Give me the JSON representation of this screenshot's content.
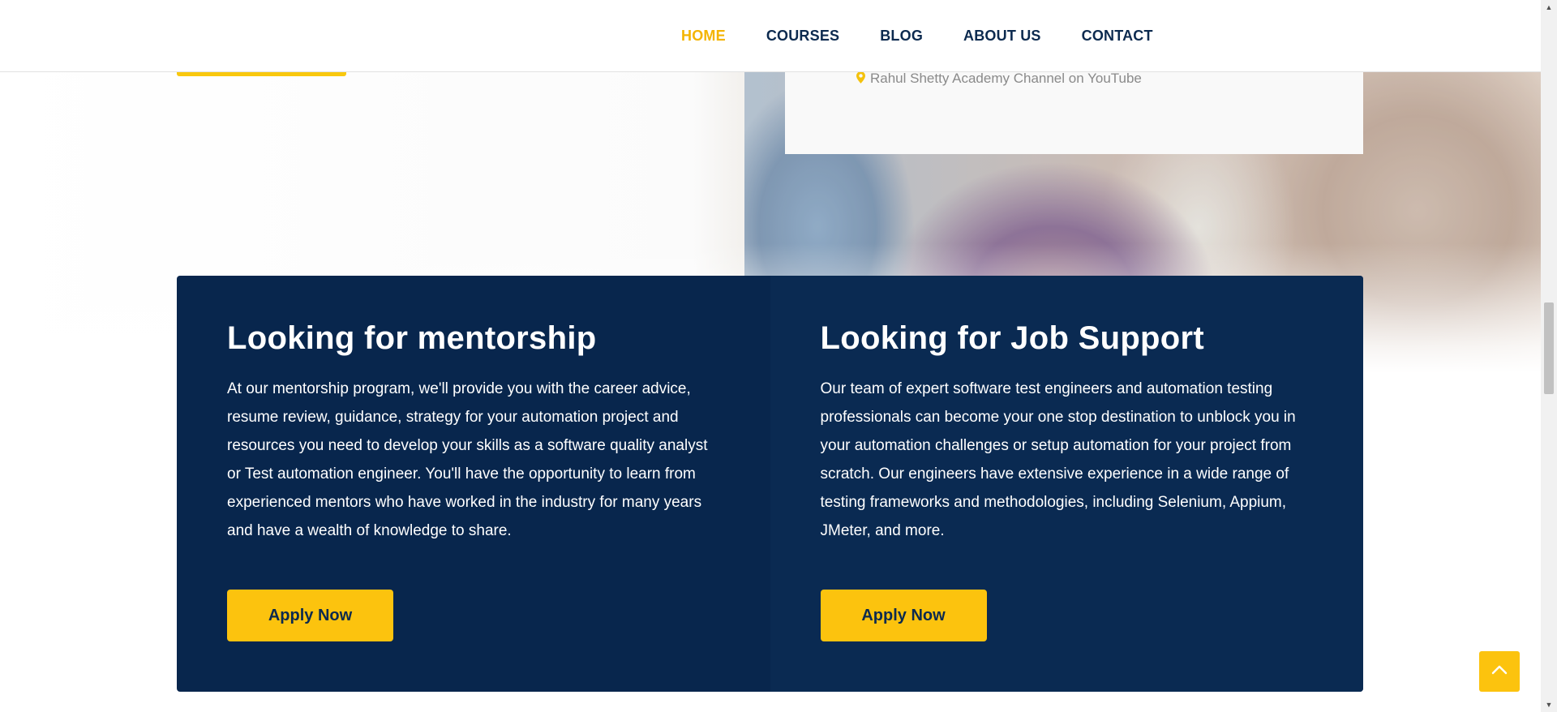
{
  "nav": {
    "items": [
      {
        "label": "HOME",
        "active": true
      },
      {
        "label": "COURSES",
        "active": false
      },
      {
        "label": "BLOG",
        "active": false
      },
      {
        "label": "ABOUT US",
        "active": false
      },
      {
        "label": "CONTACT",
        "active": false
      }
    ]
  },
  "hero": {
    "channel_text": "Rahul Shetty Academy Channel on YouTube",
    "channel_icon": "map-pin-icon"
  },
  "features": [
    {
      "title": "Looking for mentorship",
      "body": "At our mentorship program, we'll provide you with the career advice, resume review, guidance, strategy for your automation project and resources you need to develop your skills as a software quality analyst or Test automation engineer. You'll have the opportunity to learn from experienced mentors who have worked in the industry for many years and have a wealth of knowledge to share.",
      "button_label": "Apply Now"
    },
    {
      "title": "Looking for Job Support",
      "body": "Our team of expert software test engineers and automation testing professionals can become your one stop destination to unblock you in your automation challenges or setup automation for your project from scratch. Our engineers have extensive experience in a wide range of testing frameworks and methodologies, including Selenium, Appium, JMeter, and more.",
      "button_label": "Apply Now"
    }
  ],
  "scroll_to_top_icon": "chevron-up-icon",
  "colors": {
    "brand_yellow": "#fcc30e",
    "navy": "#08264d",
    "nav_text": "#0c2a4f"
  }
}
